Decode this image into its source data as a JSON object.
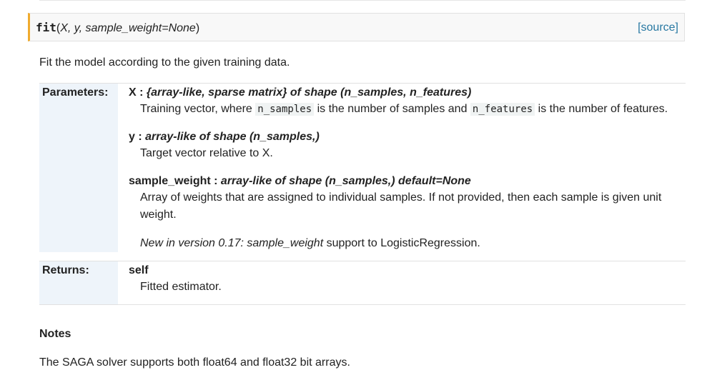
{
  "signature": {
    "name": "fit",
    "open_paren": "(",
    "args": "X, y, sample_weight=None",
    "close_paren": ")",
    "source_link": "[source]"
  },
  "description": "Fit the model according to the given training data.",
  "parameters": {
    "label": "Parameters:",
    "items": [
      {
        "name": "X",
        "sep": " : ",
        "type": "{array-like, sparse matrix} of shape (n_samples, n_features)",
        "desc": {
          "t1": "Training vector, where ",
          "c1": "n_samples",
          "t2": " is the number of samples and ",
          "c2": "n_features",
          "t3": " is the number of features."
        }
      },
      {
        "name": "y",
        "sep": " : ",
        "type": "array-like of shape (n_samples,)",
        "desc": "Target vector relative to X."
      },
      {
        "name": "sample_weight",
        "sep": " : ",
        "type": "array-like of shape (n_samples,) default=None",
        "desc": "Array of weights that are assigned to individual samples. If not provided, then each sample is given unit weight.",
        "note": {
          "version": "New in version 0.17: ",
          "emph": "sample_weight",
          "rest": " support to LogisticRegression."
        }
      }
    ]
  },
  "returns": {
    "label": "Returns:",
    "name": "self",
    "desc": "Fitted estimator."
  },
  "notes": {
    "title": "Notes",
    "text": "The SAGA solver supports both float64 and float32 bit arrays."
  }
}
